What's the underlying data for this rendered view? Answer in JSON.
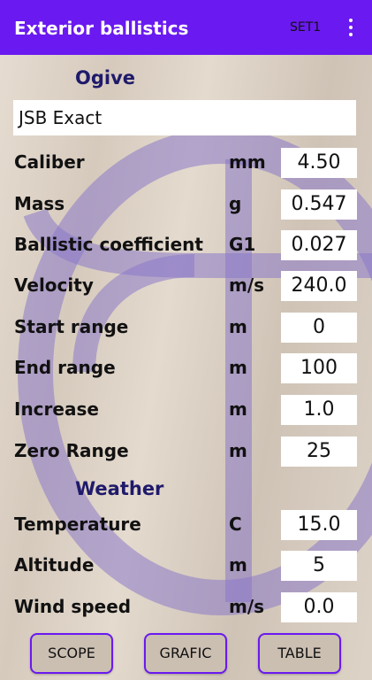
{
  "app_bar": {
    "title": "Exterior ballistics",
    "set_label": "SET1",
    "menu_icon": "more-vert-icon"
  },
  "sections": {
    "ogive_title": "Ogive",
    "weather_title": "Weather"
  },
  "ogive": {
    "name": "JSB Exact"
  },
  "projectile_rows": [
    {
      "label": "Caliber",
      "unit": "mm",
      "value": "4.50"
    },
    {
      "label": "Mass",
      "unit": "g",
      "value": "0.547"
    },
    {
      "label": "Ballistic coefficient",
      "unit": "G1",
      "value": "0.027"
    },
    {
      "label": "Velocity",
      "unit": "m/s",
      "value": "240.0"
    },
    {
      "label": "Start range",
      "unit": "m",
      "value": "0"
    },
    {
      "label": "End range",
      "unit": "m",
      "value": "100"
    },
    {
      "label": "Increase",
      "unit": "m",
      "value": "1.0"
    },
    {
      "label": "Zero Range",
      "unit": "m",
      "value": "25"
    }
  ],
  "weather_rows": [
    {
      "label": "Temperature",
      "unit": "C",
      "value": "15.0"
    },
    {
      "label": "Altitude",
      "unit": "m",
      "value": "5"
    },
    {
      "label": "Wind speed",
      "unit": "m/s",
      "value": "0.0"
    }
  ],
  "buttons": {
    "scope": "SCOPE",
    "grafic": "GRAFIC",
    "table": "TABLE"
  },
  "colors": {
    "accent": "#6a19f0",
    "section_title": "#1f1a6b",
    "watermark": "#8a78c8"
  }
}
